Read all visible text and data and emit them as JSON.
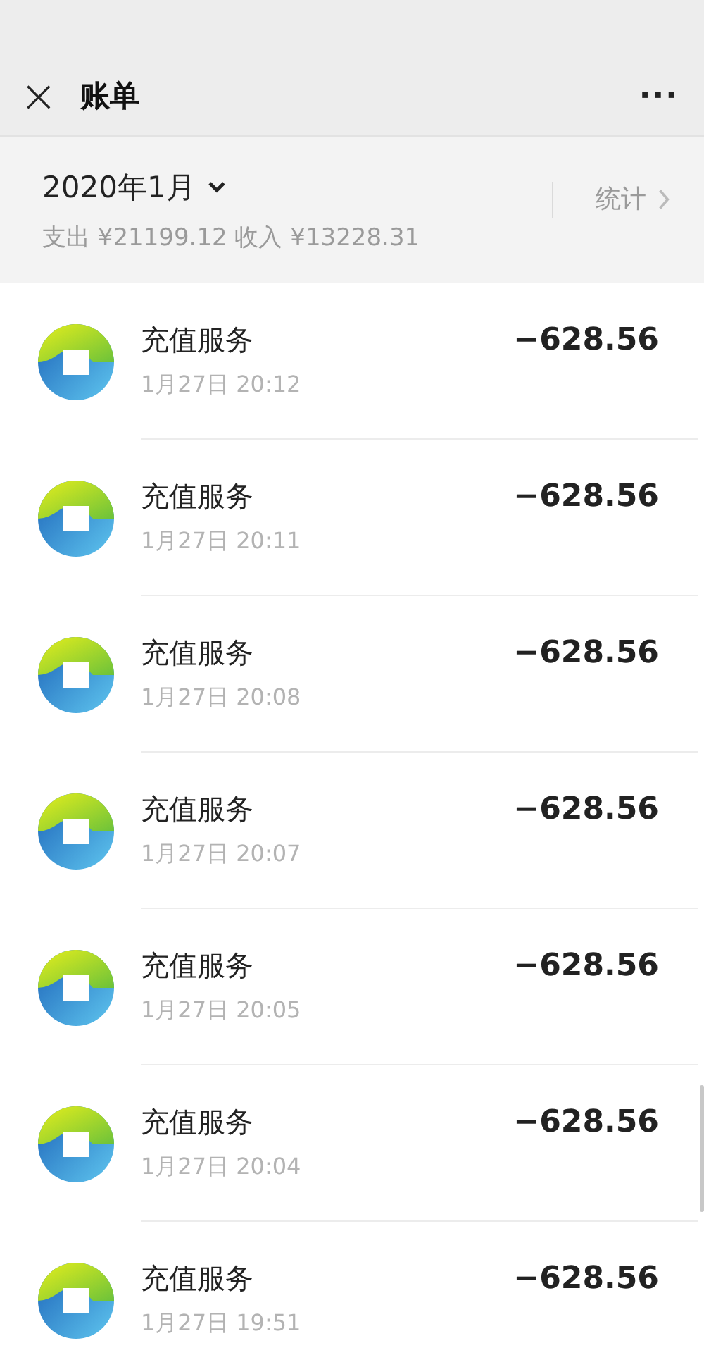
{
  "header": {
    "close": "×",
    "title": "账单",
    "more": "···"
  },
  "summary": {
    "month": "2020年1月",
    "totals": "支出 ¥21199.12 收入 ¥13228.31",
    "stats": "统计"
  },
  "transactions": [
    {
      "title": "充值服务",
      "time": "1月27日 20:12",
      "amount": "−628.56"
    },
    {
      "title": "充值服务",
      "time": "1月27日 20:11",
      "amount": "−628.56"
    },
    {
      "title": "充值服务",
      "time": "1月27日 20:08",
      "amount": "−628.56"
    },
    {
      "title": "充值服务",
      "time": "1月27日 20:07",
      "amount": "−628.56"
    },
    {
      "title": "充值服务",
      "time": "1月27日 20:05",
      "amount": "−628.56"
    },
    {
      "title": "充值服务",
      "time": "1月27日 20:04",
      "amount": "−628.56"
    },
    {
      "title": "充值服务",
      "time": "1月27日 19:51",
      "amount": "−628.56"
    }
  ]
}
